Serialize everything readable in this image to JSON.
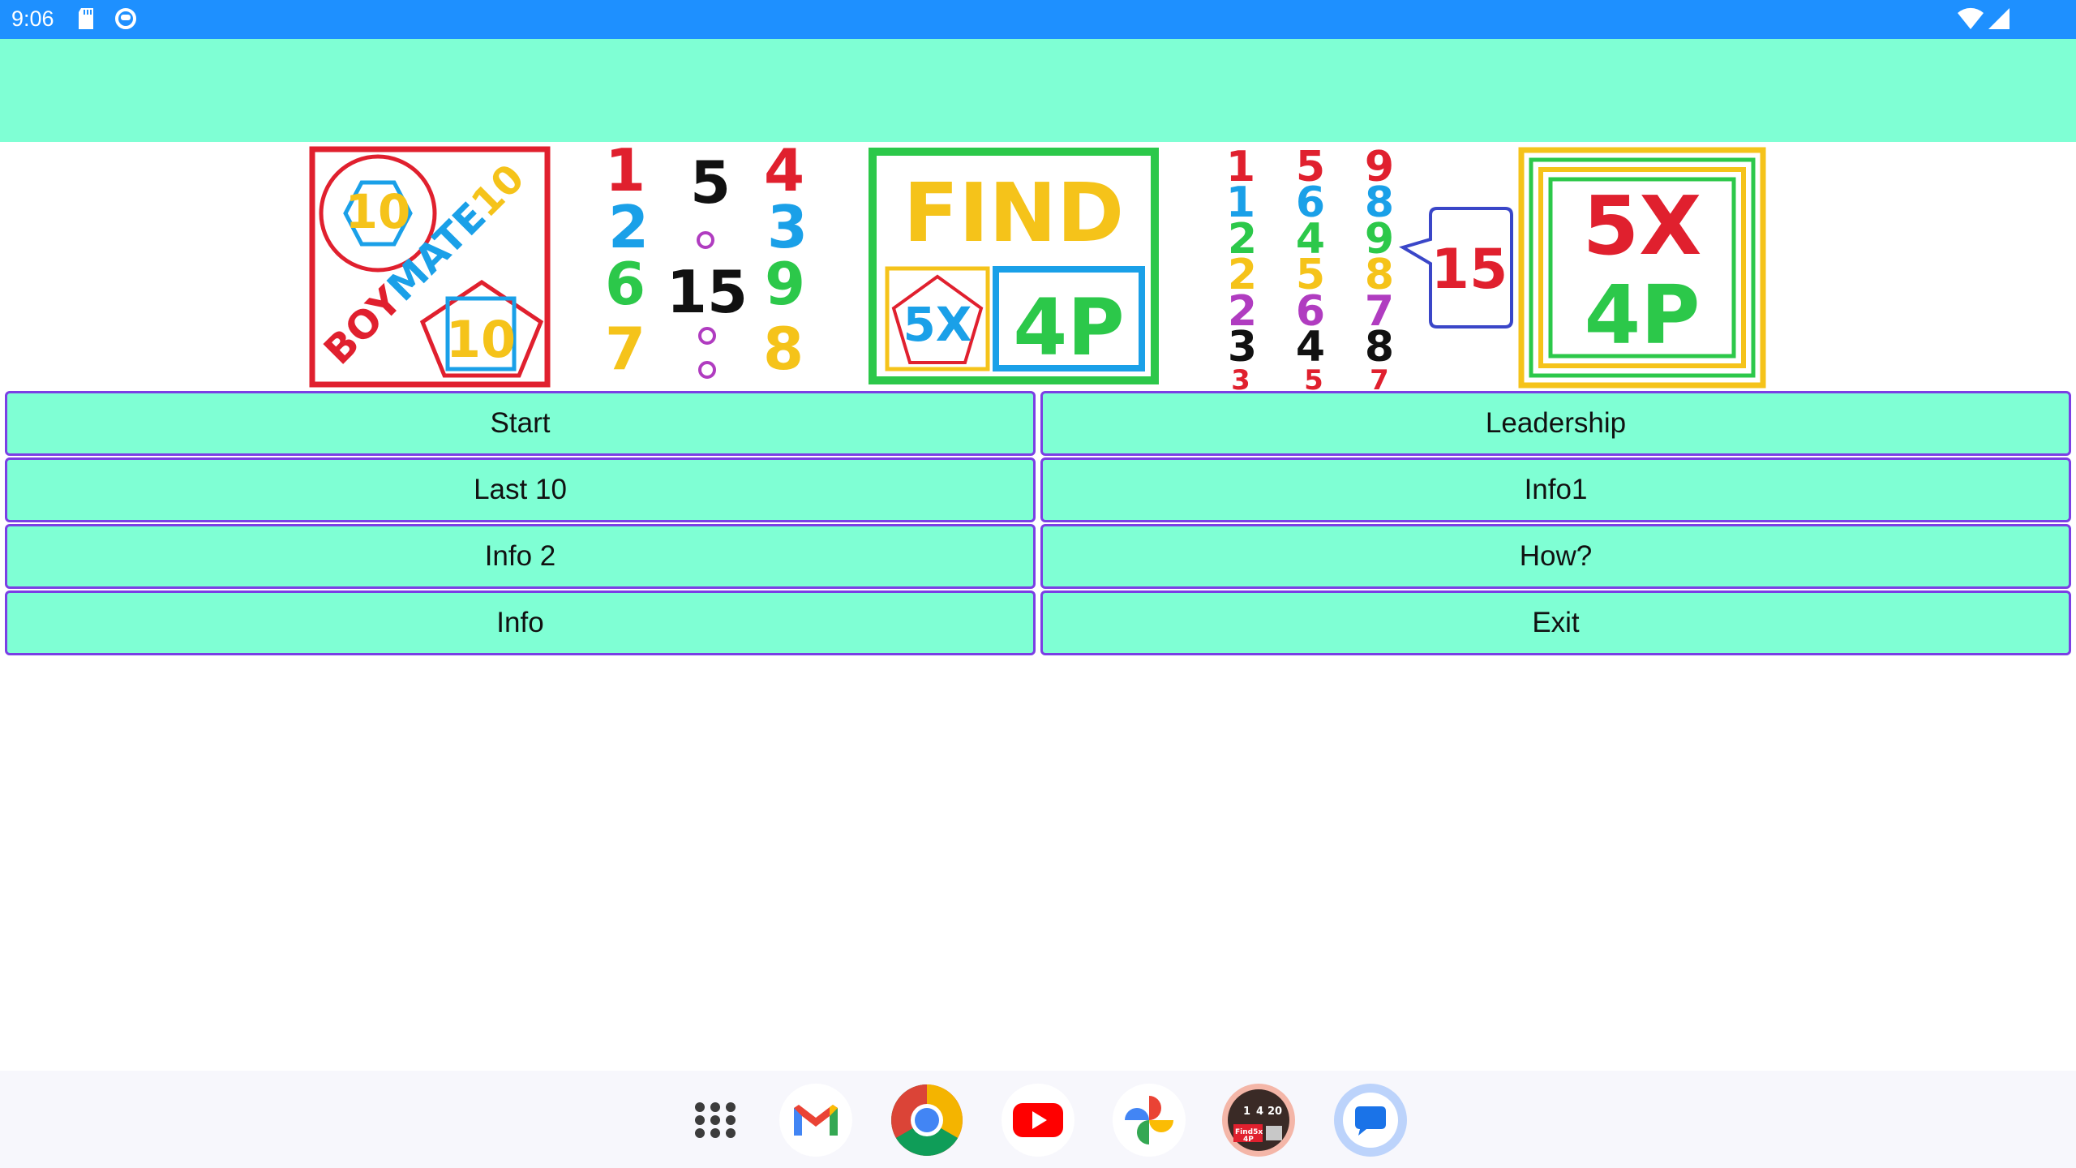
{
  "status_bar": {
    "time": "9:06",
    "left_icons": [
      "sd-card-icon",
      "sync-icon"
    ],
    "right_icons": [
      "wifi-icon",
      "signal-icon"
    ],
    "color": "#1e90ff"
  },
  "app_bar": {
    "color": "#7fffd4"
  },
  "banner": {
    "logo1": {
      "brand": "BOYMATE10",
      "hexagon_number": "10",
      "pentagon_number": "10"
    },
    "puzzle1": {
      "left_col": [
        "1",
        "2",
        "6",
        "7"
      ],
      "mid_col": [
        "5",
        "o",
        "15",
        "o",
        "o"
      ],
      "right_col": [
        "4",
        "3",
        "9",
        "8"
      ]
    },
    "logo2": {
      "title": "FIND",
      "left_label": "5X",
      "right_label": "4P"
    },
    "puzzle2": {
      "col1": [
        "1",
        "1",
        "2",
        "2",
        "2",
        "3",
        "3"
      ],
      "col2": [
        "5",
        "6",
        "4",
        "5",
        "6",
        "4",
        "5"
      ],
      "col3": [
        "9",
        "8",
        "9",
        "8",
        "7",
        "8",
        "7"
      ],
      "bubble": "15"
    },
    "logo3": {
      "line1": "5X",
      "line2": "4P"
    }
  },
  "menu": {
    "buttons": [
      {
        "label": "Start"
      },
      {
        "label": "Leadership"
      },
      {
        "label": "Last 10"
      },
      {
        "label": "Info1"
      },
      {
        "label": "Info 2"
      },
      {
        "label": "How?"
      },
      {
        "label": "Info"
      },
      {
        "label": "Exit"
      }
    ],
    "button_color": "#7fffd4",
    "border_color": "#7b3fe4"
  },
  "dock": {
    "apps": [
      "app-drawer-icon",
      "gmail-icon",
      "chrome-icon",
      "youtube-icon",
      "photos-icon",
      "find5x4p-icon",
      "messages-icon"
    ],
    "find5x4p_labels": [
      "1",
      "4",
      "20",
      "Find5x",
      "4P"
    ]
  }
}
